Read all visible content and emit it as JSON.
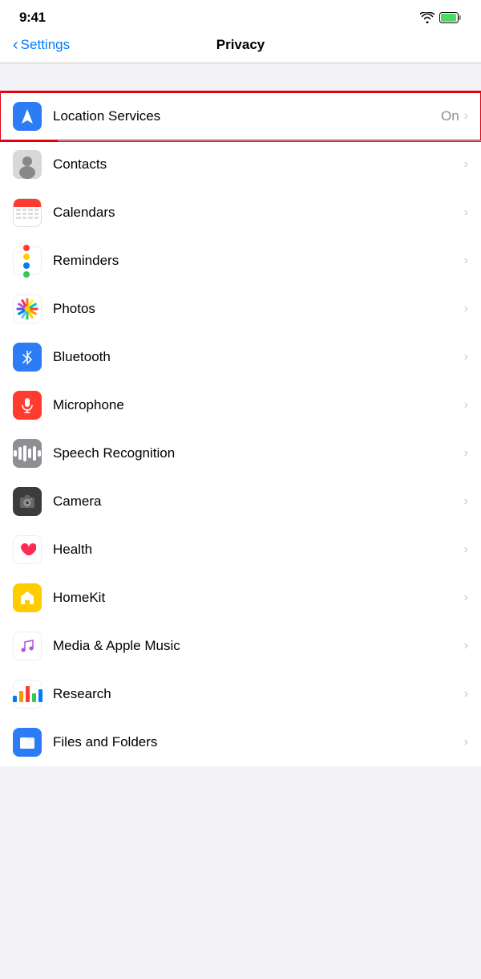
{
  "statusBar": {
    "time": "9:41",
    "wifi": "wifi-icon",
    "battery": "battery-icon"
  },
  "navBar": {
    "backLabel": "Settings",
    "title": "Privacy"
  },
  "rows": [
    {
      "id": "location-services",
      "label": "Location Services",
      "value": "On",
      "iconType": "location",
      "highlighted": true
    },
    {
      "id": "contacts",
      "label": "Contacts",
      "value": "",
      "iconType": "contacts",
      "highlighted": false
    },
    {
      "id": "calendars",
      "label": "Calendars",
      "value": "",
      "iconType": "calendars",
      "highlighted": false
    },
    {
      "id": "reminders",
      "label": "Reminders",
      "value": "",
      "iconType": "reminders",
      "highlighted": false
    },
    {
      "id": "photos",
      "label": "Photos",
      "value": "",
      "iconType": "photos",
      "highlighted": false
    },
    {
      "id": "bluetooth",
      "label": "Bluetooth",
      "value": "",
      "iconType": "bluetooth",
      "highlighted": false
    },
    {
      "id": "microphone",
      "label": "Microphone",
      "value": "",
      "iconType": "microphone",
      "highlighted": false
    },
    {
      "id": "speech-recognition",
      "label": "Speech Recognition",
      "value": "",
      "iconType": "speech",
      "highlighted": false
    },
    {
      "id": "camera",
      "label": "Camera",
      "value": "",
      "iconType": "camera",
      "highlighted": false
    },
    {
      "id": "health",
      "label": "Health",
      "value": "",
      "iconType": "health",
      "highlighted": false
    },
    {
      "id": "homekit",
      "label": "HomeKit",
      "value": "",
      "iconType": "homekit",
      "highlighted": false
    },
    {
      "id": "media-apple-music",
      "label": "Media & Apple Music",
      "value": "",
      "iconType": "music",
      "highlighted": false
    },
    {
      "id": "research",
      "label": "Research",
      "value": "",
      "iconType": "research",
      "highlighted": false
    },
    {
      "id": "files-and-folders",
      "label": "Files and Folders",
      "value": "",
      "iconType": "files",
      "highlighted": false
    }
  ]
}
